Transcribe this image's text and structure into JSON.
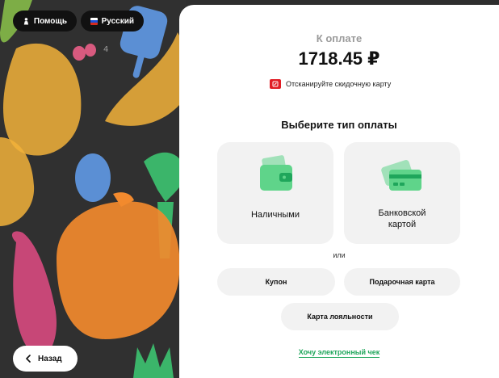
{
  "header": {
    "help_label": "Помощь",
    "language_label": "Русский"
  },
  "payment": {
    "title": "К оплате",
    "amount": "1718.45 ₽",
    "scan_discount_label": "Отсканируйте скидочную карту"
  },
  "payment_types": {
    "title": "Выберите тип оплаты",
    "cash_label": "Наличными",
    "bank_card_label_line1": "Банковской",
    "bank_card_label_line2": "картой",
    "or_label": "или"
  },
  "options": {
    "coupon_label": "Купон",
    "gift_card_label": "Подарочная карта",
    "loyalty_card_label": "Карта лояльности",
    "e_receipt_label": "Хочу электронный чек"
  },
  "navigation": {
    "back_label": "Назад"
  },
  "colors": {
    "accent_green": "#1fa65b",
    "icon_green": "#5fd48a",
    "discount_red": "#e11d25"
  }
}
